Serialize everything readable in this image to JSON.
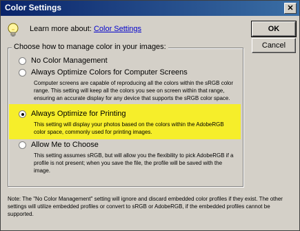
{
  "dialog": {
    "title": "Color Settings"
  },
  "header": {
    "learn_label": "Learn more about:",
    "learn_link": "Color Settings"
  },
  "buttons": {
    "ok": "OK",
    "cancel": "Cancel"
  },
  "group": {
    "legend": "Choose how to manage color in your images:"
  },
  "options": [
    {
      "label": "No Color Management",
      "checked": false
    },
    {
      "label": "Always Optimize Colors for Computer Screens",
      "checked": false,
      "description": "Computer screens are capable of reproducing all the colors within the sRGB color range. This setting will keep all the colors you see on screen within that range, ensuring an accurate display for any device that supports the sRGB color space."
    },
    {
      "label": "Always Optimize for Printing",
      "checked": true,
      "description": "This setting will display your photos based on the colors within the AdobeRGB color space, commonly used for printing images."
    },
    {
      "label": "Allow Me to Choose",
      "checked": false,
      "description": "This setting assumes sRGB, but will allow you the flexibility to pick AdobeRGB if a profile is not present; when you save the file, the profile will be saved with the image."
    }
  ],
  "note": "Note: The \"No Color Management\" setting will ignore and discard embedded color profiles if they exist. The other settings will utilize embedded profiles or convert to sRGB or AdobeRGB, if the embedded profiles cannot be supported.",
  "colors": {
    "highlight": "#f6ee2a",
    "titlebar": "#0a246a",
    "link": "#0000cc"
  },
  "icons": {
    "help": "lightbulb-icon",
    "close": "close-icon"
  }
}
